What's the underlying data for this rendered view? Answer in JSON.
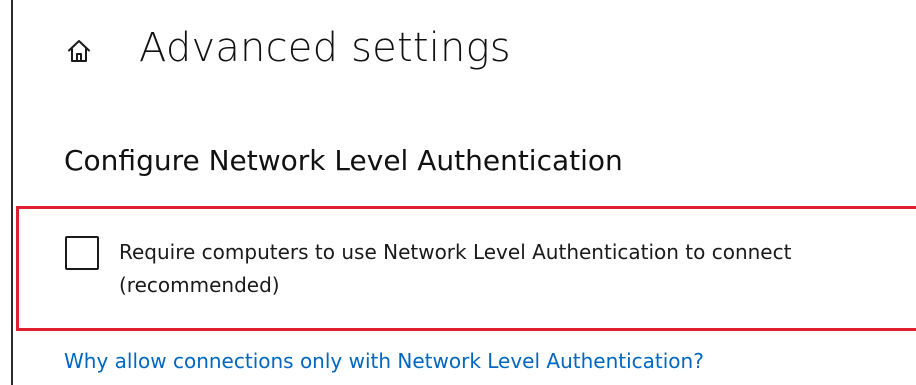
{
  "header": {
    "icon": "home-icon",
    "title": "Advanced settings"
  },
  "section": {
    "title": "Configure Network Level Authentication"
  },
  "nla_option": {
    "checked": false,
    "label_line1": "Require computers to use Network Level Authentication to connect",
    "label_line2": "(recommended)"
  },
  "help": {
    "link_text": "Why allow connections only with Network Level Authentication?"
  },
  "colors": {
    "highlight": "#e0202f",
    "link": "#0067c0"
  }
}
